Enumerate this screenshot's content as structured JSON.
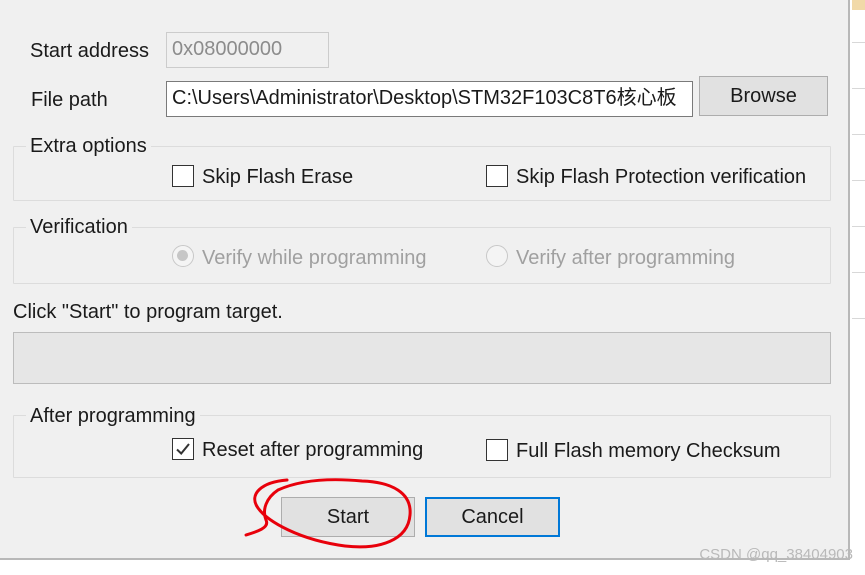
{
  "form": {
    "start_address_label": "Start address",
    "start_address_value": "0x08000000",
    "file_path_label": "File path",
    "file_path_value": "C:\\Users\\Administrator\\Desktop\\STM32F103C8T6核心板",
    "browse_label": "Browse"
  },
  "extra_options": {
    "title": "Extra options",
    "skip_flash_erase": {
      "label": "Skip Flash Erase",
      "checked": false
    },
    "skip_flash_protection": {
      "label": "Skip Flash Protection verification",
      "checked": false
    }
  },
  "verification": {
    "title": "Verification",
    "verify_while": {
      "label": "Verify while programming",
      "selected": true,
      "enabled": false
    },
    "verify_after": {
      "label": "Verify after programming",
      "selected": false,
      "enabled": false
    }
  },
  "status": {
    "message": "Click \"Start\" to program target.",
    "progress": 0
  },
  "after_programming": {
    "title": "After programming",
    "reset_after": {
      "label": "Reset after programming",
      "checked": true
    },
    "full_checksum": {
      "label": "Full Flash memory Checksum",
      "checked": false
    }
  },
  "buttons": {
    "start_label": "Start",
    "cancel_label": "Cancel"
  },
  "annotation": {
    "color": "#e8000b",
    "shape": "hand-drawn circle around Start button"
  },
  "colors": {
    "focus_blue": "#0078d7",
    "dialog_bg": "#f0f0f0"
  },
  "watermark": "CSDN @qq_38404903"
}
